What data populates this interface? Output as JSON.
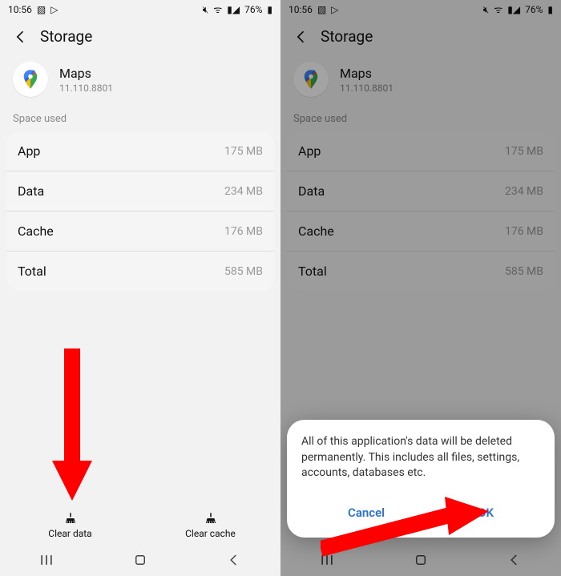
{
  "status": {
    "time": "10:56",
    "battery_pct": "76%"
  },
  "header": {
    "title": "Storage"
  },
  "app": {
    "name": "Maps",
    "version": "11.110.8801"
  },
  "section_label": "Space used",
  "rows": [
    {
      "label": "App",
      "value": "175 MB"
    },
    {
      "label": "Data",
      "value": "234 MB"
    },
    {
      "label": "Cache",
      "value": "176 MB"
    },
    {
      "label": "Total",
      "value": "585 MB"
    }
  ],
  "actions": {
    "clear_data": "Clear data",
    "clear_cache": "Clear cache"
  },
  "dialog": {
    "message": "All of this application's data will be deleted permanently. This includes all files, settings, accounts, databases etc.",
    "cancel": "Cancel",
    "ok": "OK"
  }
}
